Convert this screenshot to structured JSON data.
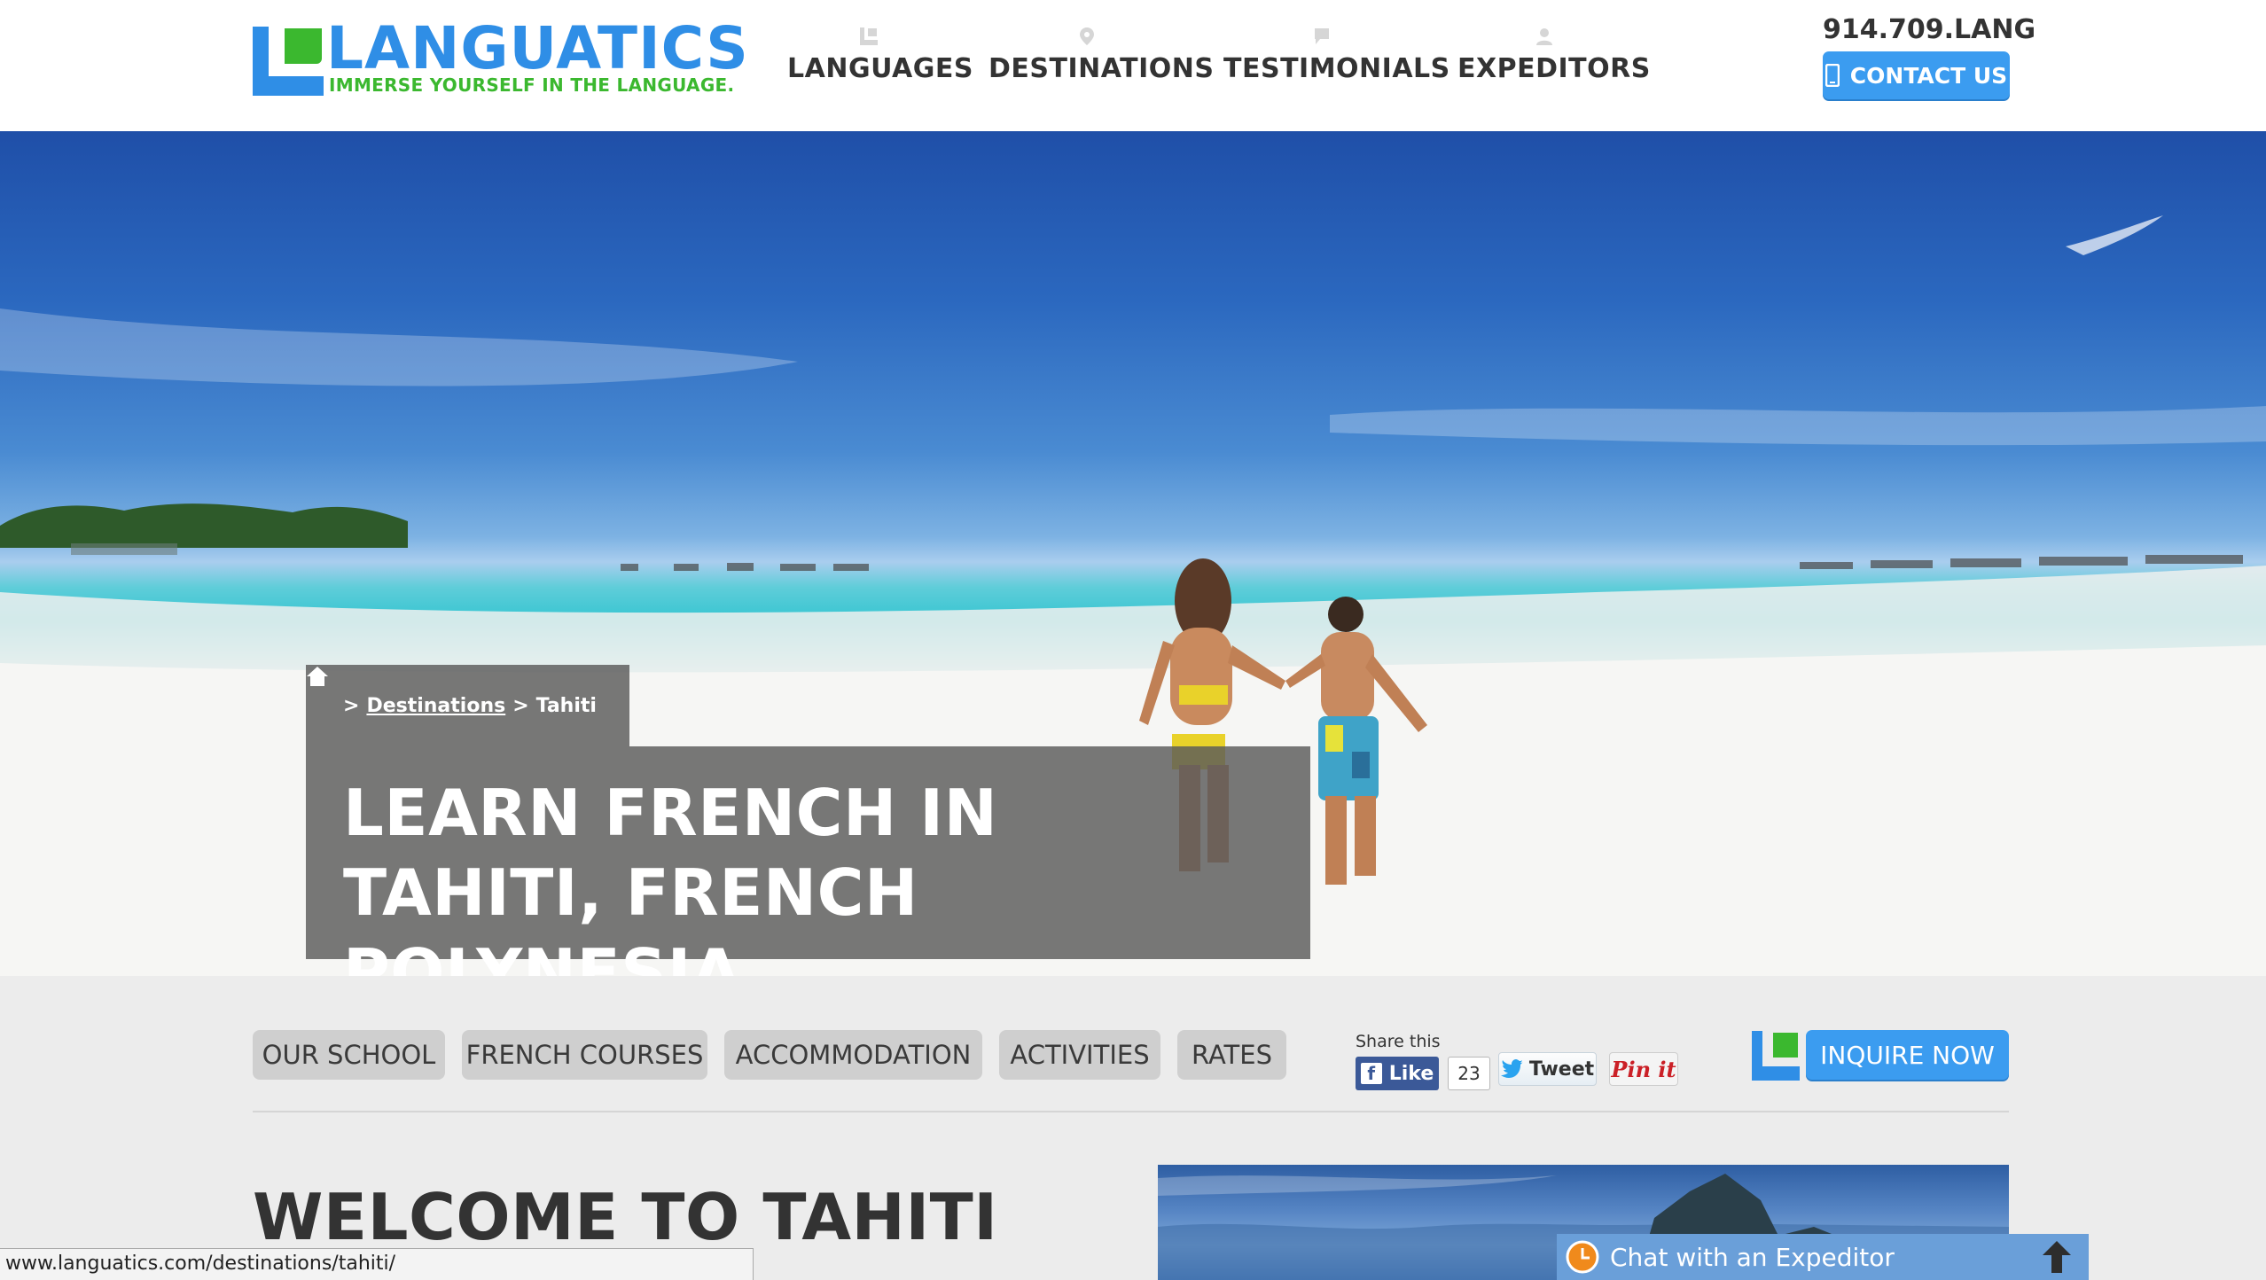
{
  "header": {
    "logo_word": "LANGUATICS",
    "logo_tagline": "IMMERSE YOURSELF IN THE LANGUAGE.",
    "nav": [
      {
        "label": "LANGUAGES",
        "icon": "languages-icon"
      },
      {
        "label": "DESTINATIONS",
        "icon": "map-pin-icon"
      },
      {
        "label": "TESTIMONIALS",
        "icon": "speech-bubble-icon"
      },
      {
        "label": "EXPEDITORS",
        "icon": "person-icon"
      }
    ],
    "phone": "914.709.LANG",
    "contact_label": "CONTACT US"
  },
  "hero": {
    "breadcrumb_sep1": ">",
    "breadcrumb_link": "Destinations",
    "breadcrumb_sep2": ">",
    "breadcrumb_current": "Tahiti",
    "title_line1": "LEARN FRENCH IN",
    "title_line2": "TAHITI, FRENCH POLYNESIA."
  },
  "subnav": {
    "tabs": [
      "OUR SCHOOL",
      "FRENCH COURSES",
      "ACCOMMODATION",
      "ACTIVITIES",
      "RATES"
    ],
    "share_label": "Share this",
    "fb_like": "Like",
    "fb_count": "23",
    "tweet": "Tweet",
    "pin": "Pin it",
    "inquire_label": "INQUIRE NOW"
  },
  "content": {
    "welcome_title": "WELCOME TO TAHITI"
  },
  "status_bar": {
    "url": "www.languatics.com/destinations/tahiti/"
  },
  "chat": {
    "label": "Chat with an Expeditor"
  },
  "colors": {
    "brand_blue": "#2f8ee6",
    "brand_green": "#3bb82f",
    "button_blue": "#3b9cf0",
    "tab_gray": "#cfcfcf"
  }
}
